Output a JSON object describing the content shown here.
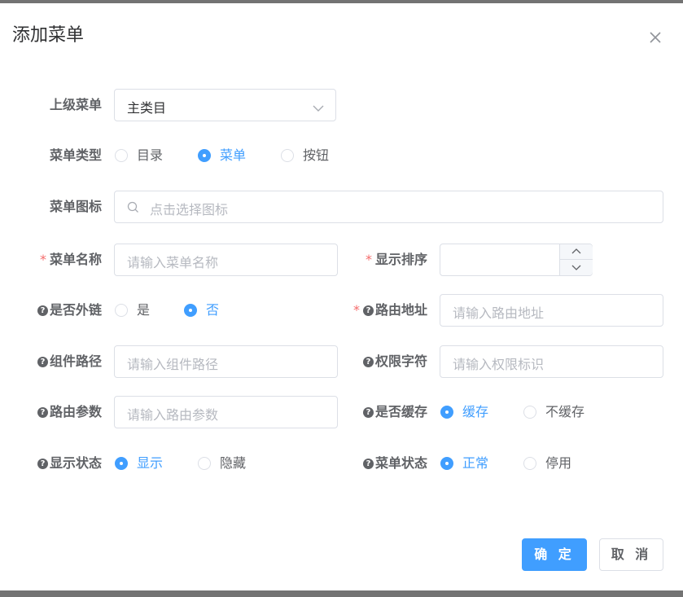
{
  "dialog": {
    "title": "添加菜单",
    "close_icon": "close-icon"
  },
  "form": {
    "parent_menu": {
      "label": "上级菜单",
      "value": "主类目"
    },
    "menu_type": {
      "label": "菜单类型",
      "options": [
        "目录",
        "菜单",
        "按钮"
      ],
      "selected": "菜单"
    },
    "menu_icon": {
      "label": "菜单图标",
      "placeholder": "点击选择图标"
    },
    "menu_name": {
      "label": "菜单名称",
      "placeholder": "请输入菜单名称",
      "required": "*"
    },
    "order": {
      "label": "显示排序",
      "value": "",
      "required": "*"
    },
    "is_frame": {
      "label": "是否外链",
      "options": [
        "是",
        "否"
      ],
      "selected": "否",
      "help": "?"
    },
    "path": {
      "label": "路由地址",
      "placeholder": "请输入路由地址",
      "required": "*",
      "help": "?"
    },
    "component": {
      "label": "组件路径",
      "placeholder": "请输入组件路径",
      "help": "?"
    },
    "perms": {
      "label": "权限字符",
      "placeholder": "请输入权限标识",
      "help": "?"
    },
    "query": {
      "label": "路由参数",
      "placeholder": "请输入路由参数",
      "help": "?"
    },
    "is_cache": {
      "label": "是否缓存",
      "options": [
        "缓存",
        "不缓存"
      ],
      "selected": "缓存",
      "help": "?"
    },
    "visible": {
      "label": "显示状态",
      "options": [
        "显示",
        "隐藏"
      ],
      "selected": "显示",
      "help": "?"
    },
    "status": {
      "label": "菜单状态",
      "options": [
        "正常",
        "停用"
      ],
      "selected": "正常",
      "help": "?"
    }
  },
  "footer": {
    "confirm": "确 定",
    "cancel": "取 消"
  },
  "colors": {
    "primary": "#409eff",
    "required": "#f56c6c",
    "border": "#dcdfe6",
    "placeholder": "#b6b9c0"
  }
}
